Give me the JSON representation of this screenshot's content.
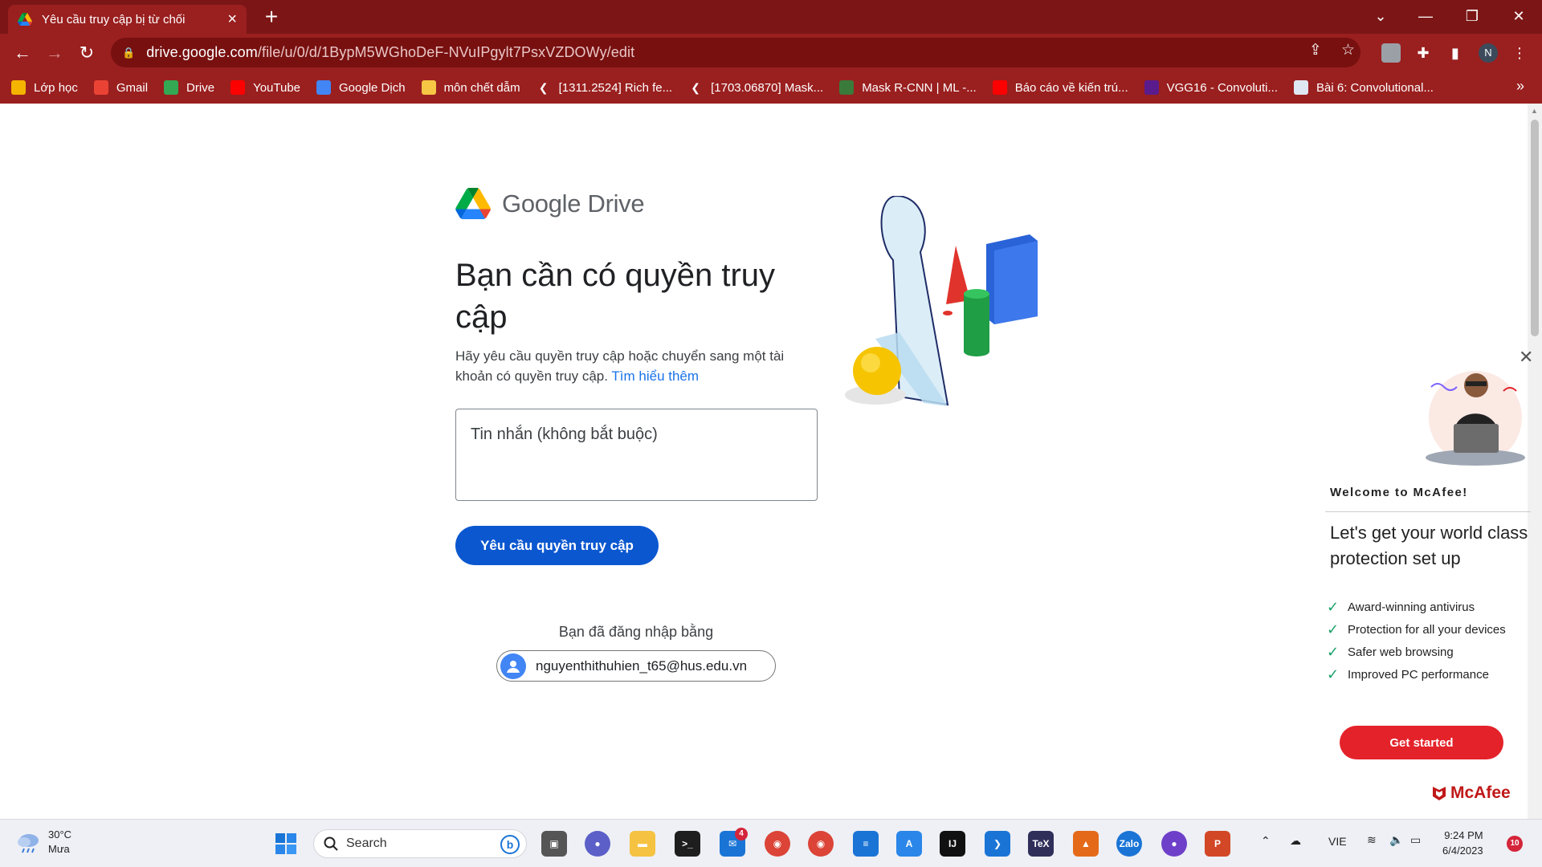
{
  "browser": {
    "tab_title": "Yêu cầu truy cập bị từ chối",
    "url_host": "drive.google.com",
    "url_path": "/file/u/0/d/1BypM5WGhoDeF-NVuIPgylt7PsxVZDOWy/edit"
  },
  "bookmarks": [
    {
      "label": "Lớp học",
      "icon": "classroom-icon",
      "color": "#f4b400"
    },
    {
      "label": "Gmail",
      "icon": "gmail-icon",
      "color": "#ea4335"
    },
    {
      "label": "Drive",
      "icon": "drive-icon",
      "color": "#34a853"
    },
    {
      "label": "YouTube",
      "icon": "youtube-icon",
      "color": "#ff0000"
    },
    {
      "label": "Google Dịch",
      "icon": "translate-icon",
      "color": "#4285f4"
    },
    {
      "label": "môn chết dẫm",
      "icon": "folder-icon",
      "color": "#f6c644"
    },
    {
      "label": "[1311.2524] Rich fe...",
      "icon": "arxiv-icon",
      "color": "#9a1f1f"
    },
    {
      "label": "[1703.06870] Mask...",
      "icon": "arxiv-icon",
      "color": "#9a1f1f"
    },
    {
      "label": "Mask R-CNN | ML -...",
      "icon": "site-icon",
      "color": "#3a7a3a"
    },
    {
      "label": "Báo cáo về kiến trú...",
      "icon": "youtube-icon",
      "color": "#ff0000"
    },
    {
      "label": "VGG16 - Convoluti...",
      "icon": "site-icon",
      "color": "#5a1b8c"
    },
    {
      "label": "Bài 6: Convolutional...",
      "icon": "site-icon",
      "color": "#dfe7f2"
    }
  ],
  "page": {
    "logo_text": "Google Drive",
    "headline": "Bạn cần có quyền truy cập",
    "description": "Hãy yêu cầu quyền truy cập hoặc chuyển sang một tài khoản có quyền truy cập.",
    "learn_more": "Tìm hiểu thêm",
    "message_placeholder": "Tin nhắn (không bắt buộc)",
    "request_button": "Yêu cầu quyền truy cập",
    "signed_in_label": "Bạn đã đăng nhập bằng",
    "account_email": "nguyenthithuhien_t65@hus.edu.vn"
  },
  "mcafee": {
    "welcome": "Welcome to McAfee!",
    "heading": "Let's get your world class protection set up",
    "features": [
      "Award-winning antivirus",
      "Protection for all your devices",
      "Safer web browsing",
      "Improved PC performance"
    ],
    "button": "Get started",
    "brand": "McAfee"
  },
  "taskbar": {
    "temperature": "30°C",
    "condition": "Mưa",
    "search_label": "Search",
    "mail_badge": "4",
    "language": "VIE",
    "time": "9:24 PM",
    "date": "6/4/2023",
    "notification_count": "10"
  }
}
